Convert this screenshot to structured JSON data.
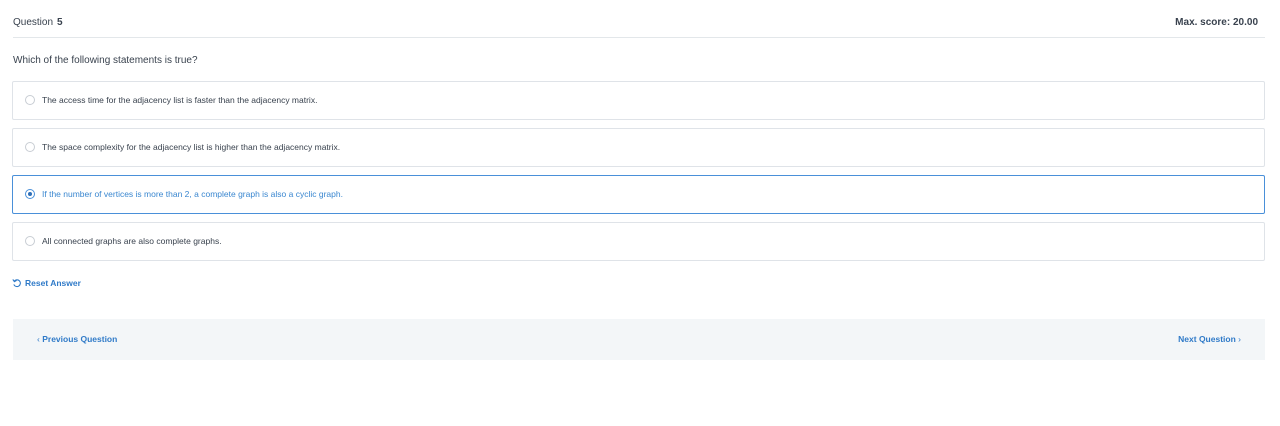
{
  "header": {
    "question_label": "Question",
    "question_number": "5",
    "max_score": "Max. score: 20.00"
  },
  "question": {
    "text": "Which of the following statements is true?"
  },
  "options": [
    {
      "label": "The access time for the adjacency list is faster than the adjacency matrix.",
      "selected": false
    },
    {
      "label": "The space complexity for the adjacency list is higher than the adjacency matrix.",
      "selected": false
    },
    {
      "label": "If the number of vertices is more than 2, a complete graph is also a cyclic graph.",
      "selected": true
    },
    {
      "label": "All connected graphs are also complete graphs.",
      "selected": false
    }
  ],
  "reset": {
    "label": "Reset Answer",
    "icon": "undo-icon"
  },
  "navigation": {
    "prev_label": "Previous Question",
    "next_label": "Next Question",
    "prev_icon": "chevron-left-icon",
    "next_icon": "chevron-right-icon"
  },
  "colors": {
    "accent": "#2f7ac8",
    "selected_border": "#4a90d9",
    "nav_bg": "#f3f6f8",
    "text": "#39424e"
  }
}
